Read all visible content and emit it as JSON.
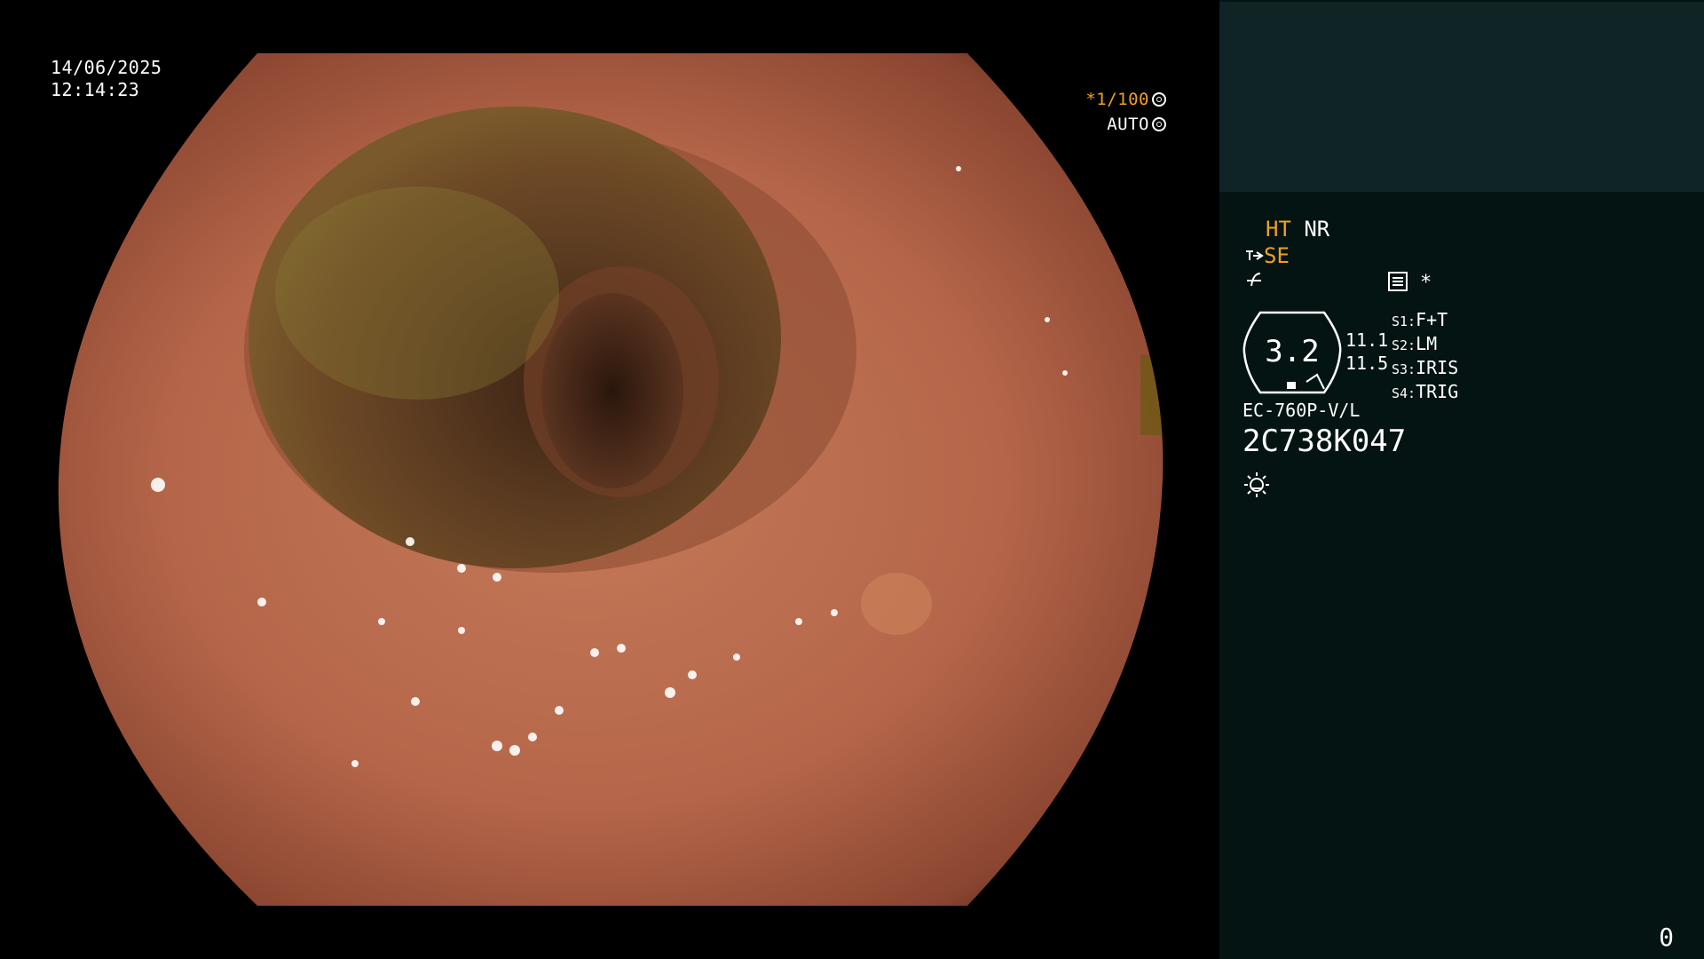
{
  "overlay": {
    "date": "14/06/2025",
    "time": "12:14:23",
    "shutter_star": "*",
    "shutter": "1/100",
    "auto": "AUTO"
  },
  "panel": {
    "mode_ht": "HT",
    "mode_nr": "NR",
    "mode_se": "SE",
    "star": "*",
    "zoom": "3.2",
    "gain_1": "11.1",
    "gain_2": "11.5",
    "switches": [
      {
        "key": "S1:",
        "value": "F+T"
      },
      {
        "key": "S2:",
        "value": "LM"
      },
      {
        "key": "S3:",
        "value": "IRIS"
      },
      {
        "key": "S4:",
        "value": "TRIG"
      }
    ],
    "scope_model": "EC-760P-V/L",
    "serial": "2C738K047",
    "page_number": "0"
  },
  "colors": {
    "accent_orange": "#f0a020",
    "panel_bg": "#031413",
    "panel_top_bg": "#0e2425",
    "mucosa": "#b8684a"
  },
  "icons": [
    "shutter-icon",
    "auto-iris-icon",
    "se-mode-icon",
    "structure-enhance-icon",
    "preset-icon",
    "zoom-indicator-icon",
    "light-icon"
  ]
}
